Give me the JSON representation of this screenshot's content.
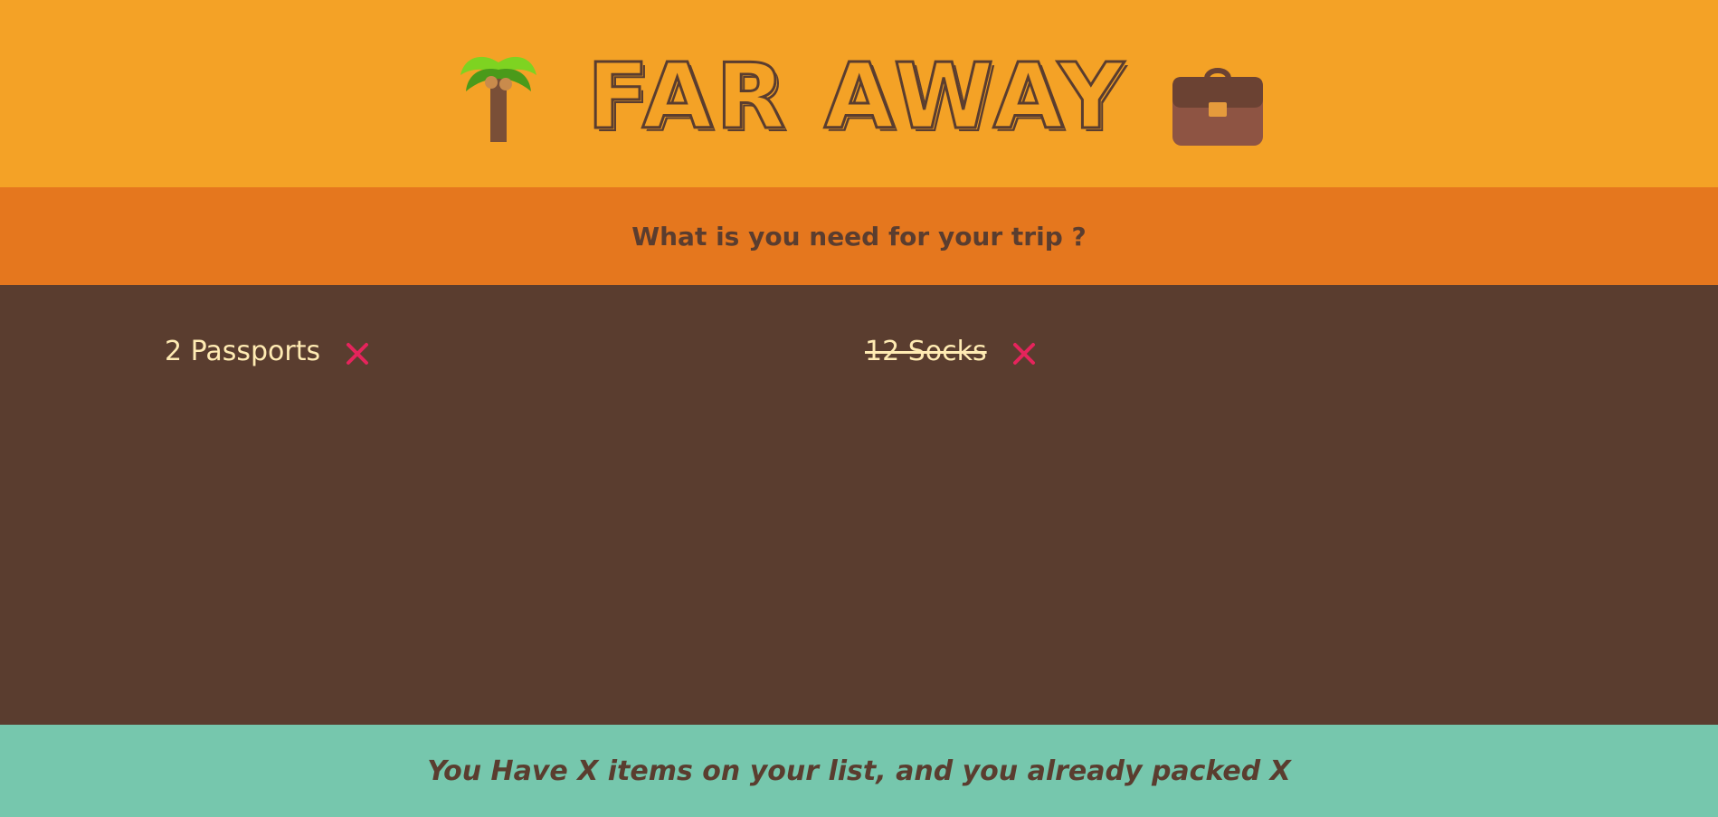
{
  "header": {
    "title": "FAR AWAY",
    "left_icon": "palm-tree-icon",
    "right_icon": "briefcase-icon"
  },
  "form": {
    "question": "What is you need for your trip ?"
  },
  "list": {
    "items": [
      {
        "label": "2 Passports",
        "packed": false,
        "delete_icon": "close-icon"
      },
      {
        "label": "12 Socks",
        "packed": true,
        "delete_icon": "close-icon"
      }
    ]
  },
  "stats": {
    "text": "You Have X items on your list, and you already packed X"
  },
  "colors": {
    "header_bg": "#f4a226",
    "form_bg": "#e5771e",
    "list_bg": "#5a3d2f",
    "footer_bg": "#76c7ad",
    "text_dark": "#5a3d2f",
    "text_light": "#ffebb3",
    "delete_red": "#e5245c"
  }
}
